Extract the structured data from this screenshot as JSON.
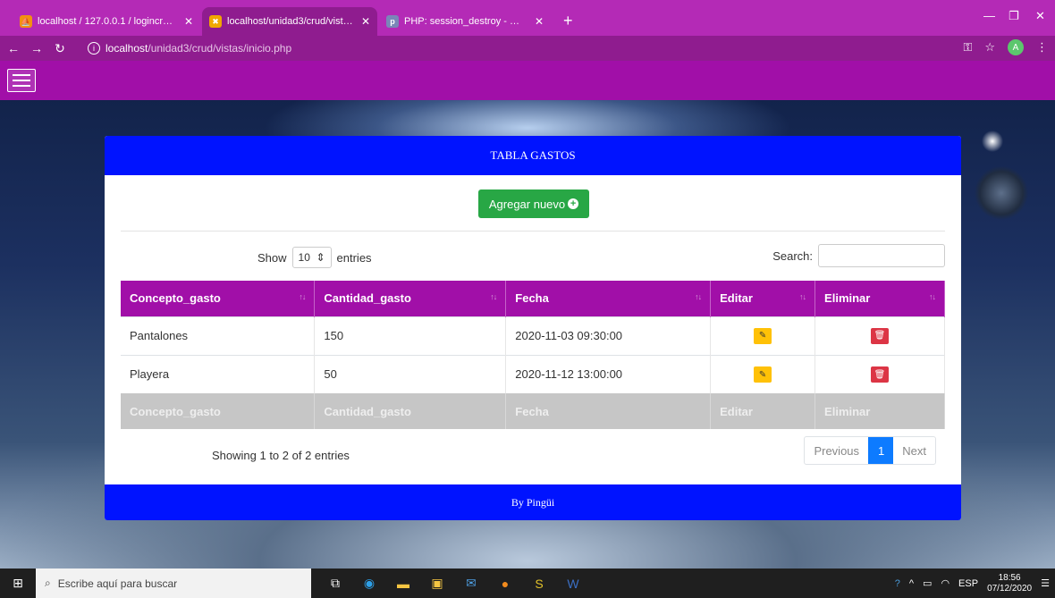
{
  "browser": {
    "tabs": [
      {
        "title": "localhost / 127.0.0.1 / logincrud /",
        "active": false
      },
      {
        "title": "localhost/unidad3/crud/vistas/in",
        "active": true
      },
      {
        "title": "PHP: session_destroy - Manual",
        "active": false
      }
    ],
    "url_host": "localhost",
    "url_path": "/unidad3/crud/vistas/inicio.php",
    "profile_initial": "A"
  },
  "card": {
    "title": "TABLA GASTOS",
    "add_label": "Agregar nuevo",
    "show_label": "Show",
    "entries_value": "10",
    "entries_label": "entries",
    "search_label": "Search:",
    "footer": "By Pingüi"
  },
  "table": {
    "headers": [
      "Concepto_gasto",
      "Cantidad_gasto",
      "Fecha",
      "Editar",
      "Eliminar"
    ],
    "rows": [
      {
        "concepto": "Pantalones",
        "cantidad": "150",
        "fecha": "2020-11-03 09:30:00"
      },
      {
        "concepto": "Playera",
        "cantidad": "50",
        "fecha": "2020-11-12 13:00:00"
      }
    ],
    "footer_headers": [
      "Concepto_gasto",
      "Cantidad_gasto",
      "Fecha",
      "Editar",
      "Eliminar"
    ]
  },
  "pagination": {
    "info": "Showing 1 to 2 of 2 entries",
    "previous": "Previous",
    "current": "1",
    "next": "Next"
  },
  "taskbar": {
    "search_placeholder": "Escribe aquí para buscar",
    "language": "ESP",
    "time": "18:56",
    "date": "07/12/2020"
  },
  "colors": {
    "tabbar": "#b42ab6",
    "navbar": "#a10fa8",
    "card_header": "#0013ff",
    "add_button": "#28a745",
    "edit_button": "#ffc107",
    "delete_button": "#dc3545"
  }
}
